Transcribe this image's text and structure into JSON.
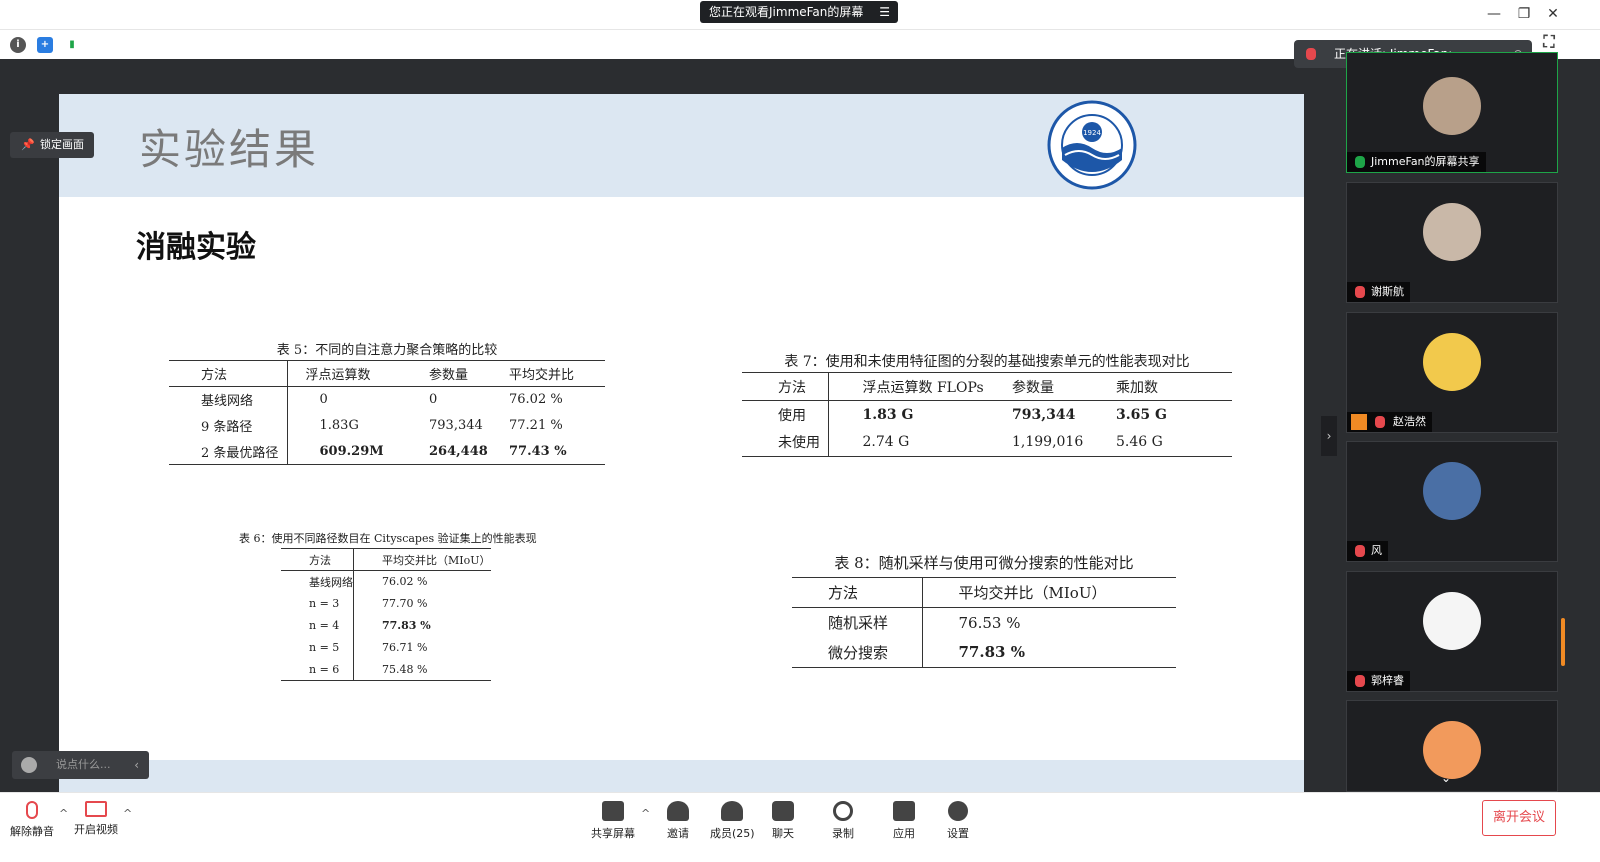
{
  "titlebar": {
    "watching": "您正在观看JimmeFan的屏幕"
  },
  "stage": {
    "lock_label": "锁定画面",
    "chat_placeholder": "说点什么..."
  },
  "slide": {
    "title": "实验结果",
    "subtitle": "消融实验",
    "logo": {
      "year": "1924",
      "name": "OCEAN UNIVERSITY OF CHINA",
      "cn": "中国海洋大学"
    },
    "table5": {
      "caption": "表 5：不同的自注意力聚合策略的比较",
      "headers": [
        "方法",
        "浮点运算数",
        "参数量",
        "平均交并比"
      ],
      "rows": [
        [
          "基线网络",
          "0",
          "0",
          "76.02 %"
        ],
        [
          "9 条路径",
          "1.83G",
          "793,344",
          "77.21 %"
        ],
        [
          "2 条最优路径",
          "609.29M",
          "264,448",
          "77.43 %"
        ]
      ]
    },
    "table6": {
      "caption": "表 6：使用不同路径数目在 Cityscapes 验证集上的性能表现",
      "headers": [
        "方法",
        "平均交并比（MIoU）"
      ],
      "rows": [
        [
          "基线网络",
          "76.02 %"
        ],
        [
          "n = 3",
          "77.70 %"
        ],
        [
          "n = 4",
          "77.83 %"
        ],
        [
          "n = 5",
          "76.71 %"
        ],
        [
          "n = 6",
          "75.48 %"
        ]
      ]
    },
    "table7": {
      "caption": "表 7：使用和未使用特征图的分裂的基础搜索单元的性能表现对比",
      "headers": [
        "方法",
        "浮点运算数 FLOPs",
        "参数量",
        "乘加数"
      ],
      "rows": [
        [
          "使用",
          "1.83 G",
          "793,344",
          "3.65 G"
        ],
        [
          "未使用",
          "2.74 G",
          "1,199,016",
          "5.46 G"
        ]
      ]
    },
    "table8": {
      "caption": "表 8：随机采样与使用可微分搜索的性能对比",
      "headers": [
        "方法",
        "平均交并比（MIoU）"
      ],
      "rows": [
        [
          "随机采样",
          "76.53 %"
        ],
        [
          "微分搜索",
          "77.83 %"
        ]
      ]
    }
  },
  "panel": {
    "speaking": "正在讲话: JimmeFan;",
    "participants": [
      {
        "name": "JimmeFan的屏幕共享",
        "color": "#b8a08a"
      },
      {
        "name": "谢斯航",
        "color": "#c9b8a8"
      },
      {
        "name": "赵浩然",
        "color": "#f2c94c"
      },
      {
        "name": "风",
        "color": "#4a6fa5"
      },
      {
        "name": "郭梓睿",
        "color": "#f5f5f5"
      },
      {
        "name": "",
        "color": "#f29a5c"
      }
    ]
  },
  "bottombar": {
    "unmute": "解除静音",
    "video": "开启视频",
    "share": "共享屏幕",
    "invite": "邀请",
    "members": "成员(25)",
    "chat": "聊天",
    "record": "录制",
    "apps": "应用",
    "settings": "设置",
    "leave": "离开会议"
  }
}
